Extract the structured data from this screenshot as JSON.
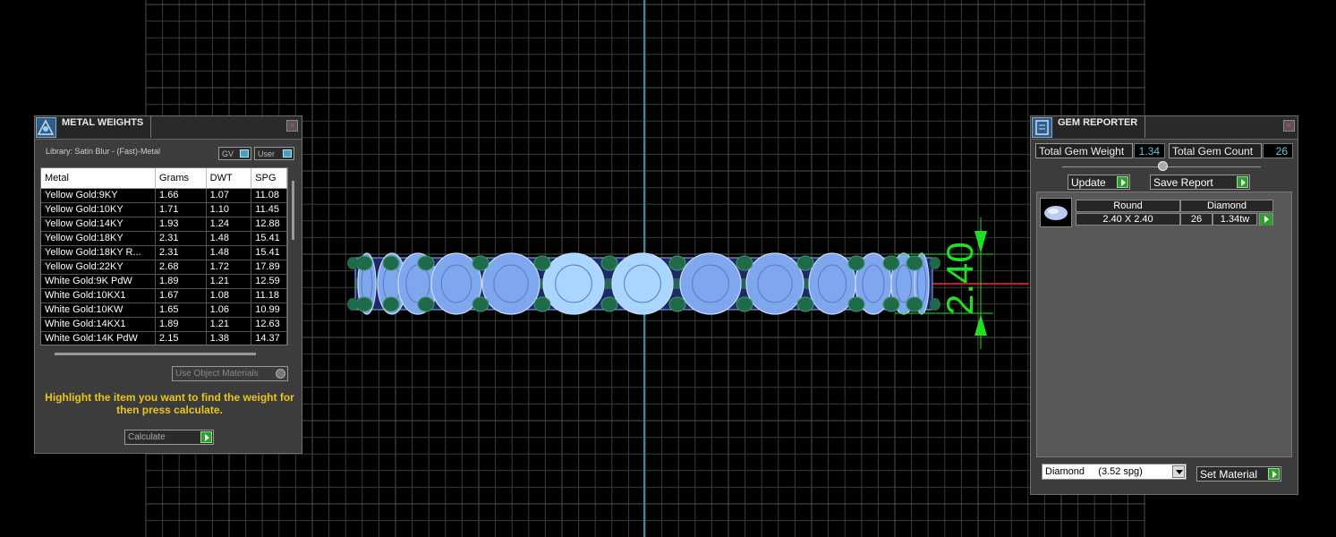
{
  "viewport": {
    "dimension_label": "2.40",
    "colors": {
      "background": "#000000",
      "grid": "#3a3a3a",
      "gem": "#7fa7ee",
      "prong": "#1f6a4a",
      "dimension": "#22dd22",
      "axis_v": "#2a8fb0",
      "axis_h": "#c02020"
    }
  },
  "metal_weights": {
    "title": "METAL WEIGHTS",
    "library": "Library: Satin Blur - (Fast)-Metal",
    "toggle_gv": "GV",
    "toggle_user": "User",
    "columns": [
      "Metal",
      "Grams",
      "DWT",
      "SPG"
    ],
    "rows": [
      [
        "Yellow Gold:9KY",
        "1.66",
        "1.07",
        "11.08"
      ],
      [
        "Yellow Gold:10KY",
        "1.71",
        "1.10",
        "11.45"
      ],
      [
        "Yellow Gold:14KY",
        "1.93",
        "1.24",
        "12.88"
      ],
      [
        "Yellow Gold:18KY",
        "2.31",
        "1.48",
        "15.41"
      ],
      [
        "Yellow Gold:18KY R...",
        "2.31",
        "1.48",
        "15.41"
      ],
      [
        "Yellow Gold:22KY",
        "2.68",
        "1.72",
        "17.89"
      ],
      [
        "White Gold:9K PdW",
        "1.89",
        "1.21",
        "12.59"
      ],
      [
        "White Gold:10KX1",
        "1.67",
        "1.08",
        "11.18"
      ],
      [
        "White Gold:10KW",
        "1.65",
        "1.06",
        "10.99"
      ],
      [
        "White Gold:14KX1",
        "1.89",
        "1.21",
        "12.63"
      ],
      [
        "White Gold:14K PdW",
        "2.15",
        "1.38",
        "14.37"
      ]
    ],
    "use_object_materials": "Use Object Materials",
    "hint": "Highlight the item you want to find the weight for then press calculate.",
    "calculate": "Calculate",
    "close": "×"
  },
  "gem_reporter": {
    "title": "GEM REPORTER",
    "total_weight_label": "Total Gem Weight",
    "total_weight_value": "1.34",
    "total_count_label": "Total Gem Count",
    "total_count_value": "26",
    "update": "Update",
    "save_report": "Save Report",
    "columns": [
      "Round",
      "Diamond"
    ],
    "gem": {
      "size": "2.40 X 2.40",
      "count": "26",
      "weight": "1.34tw"
    },
    "material": "Diamond     (3.52 spg)",
    "set_material": "Set Material",
    "close": "×"
  }
}
